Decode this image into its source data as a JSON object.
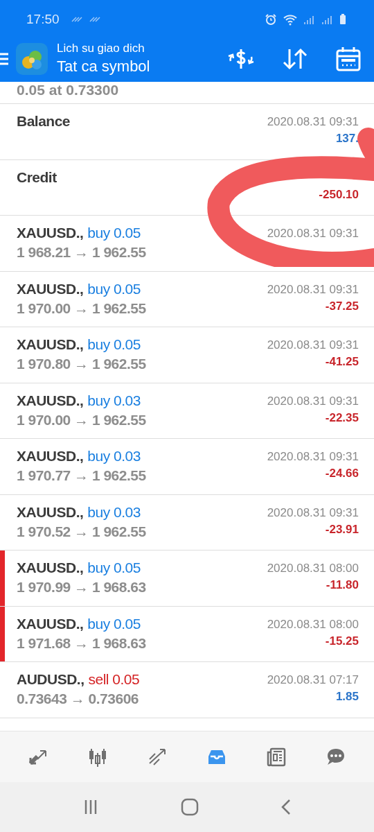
{
  "status_bar": {
    "time": "17:50"
  },
  "header": {
    "title": "Lich su giao dich",
    "subtitle": "Tat ca symbol"
  },
  "partial_top": "0.05 at 0.73300",
  "entries": [
    {
      "kind": "balance",
      "title": "Balance",
      "date": "2020.08.31 09:31",
      "amount": {
        "text": "137.",
        "color": "#2a74c9"
      },
      "marked": false
    },
    {
      "kind": "balance",
      "title": "Credit",
      "amount": {
        "text": "-250.10",
        "color": "#c8252b"
      },
      "marked": false
    },
    {
      "kind": "trade",
      "symbol": "XAUUSD.,",
      "action": {
        "text": "buy 0.05",
        "color": "#1a7fe0"
      },
      "prices": "1 968.21 → 1 962.55",
      "date": "2020.08.31 09:31",
      "marked": false
    },
    {
      "kind": "trade",
      "symbol": "XAUUSD.,",
      "action": {
        "text": "buy 0.05",
        "color": "#1a7fe0"
      },
      "prices": "1 970.00 → 1 962.55",
      "date": "2020.08.31 09:31",
      "amount": {
        "text": "-37.25",
        "color": "#c8252b"
      },
      "marked": false
    },
    {
      "kind": "trade",
      "symbol": "XAUUSD.,",
      "action": {
        "text": "buy 0.05",
        "color": "#1a7fe0"
      },
      "prices": "1 970.80 → 1 962.55",
      "date": "2020.08.31 09:31",
      "amount": {
        "text": "-41.25",
        "color": "#c8252b"
      },
      "marked": false
    },
    {
      "kind": "trade",
      "symbol": "XAUUSD.,",
      "action": {
        "text": "buy 0.03",
        "color": "#1a7fe0"
      },
      "prices": "1 970.00 → 1 962.55",
      "date": "2020.08.31 09:31",
      "amount": {
        "text": "-22.35",
        "color": "#c8252b"
      },
      "marked": false
    },
    {
      "kind": "trade",
      "symbol": "XAUUSD.,",
      "action": {
        "text": "buy 0.03",
        "color": "#1a7fe0"
      },
      "prices": "1 970.77 → 1 962.55",
      "date": "2020.08.31 09:31",
      "amount": {
        "text": "-24.66",
        "color": "#c8252b"
      },
      "marked": false
    },
    {
      "kind": "trade",
      "symbol": "XAUUSD.,",
      "action": {
        "text": "buy 0.03",
        "color": "#1a7fe0"
      },
      "prices": "1 970.52 → 1 962.55",
      "date": "2020.08.31 09:31",
      "amount": {
        "text": "-23.91",
        "color": "#c8252b"
      },
      "marked": false
    },
    {
      "kind": "trade",
      "symbol": "XAUUSD.,",
      "action": {
        "text": "buy 0.05",
        "color": "#1a7fe0"
      },
      "prices": "1 970.99 → 1 968.63",
      "date": "2020.08.31 08:00",
      "amount": {
        "text": "-11.80",
        "color": "#c8252b"
      },
      "marked": true
    },
    {
      "kind": "trade",
      "symbol": "XAUUSD.,",
      "action": {
        "text": "buy 0.05",
        "color": "#1a7fe0"
      },
      "prices": "1 971.68 → 1 968.63",
      "date": "2020.08.31 08:00",
      "amount": {
        "text": "-15.25",
        "color": "#c8252b"
      },
      "marked": true
    },
    {
      "kind": "trade",
      "symbol": "AUDUSD.,",
      "action": {
        "text": "sell 0.05",
        "color": "#d42224"
      },
      "prices": "0.73643 → 0.73606",
      "date": "2020.08.31 07:17",
      "amount": {
        "text": "1.85",
        "color": "#2a74c9"
      },
      "marked": false
    }
  ],
  "tabs": [
    {
      "kind": "quotes",
      "selected": false
    },
    {
      "kind": "chart",
      "selected": false
    },
    {
      "kind": "trade",
      "selected": false
    },
    {
      "kind": "history",
      "selected": true
    },
    {
      "kind": "news",
      "selected": false
    },
    {
      "kind": "chat",
      "selected": false
    }
  ]
}
